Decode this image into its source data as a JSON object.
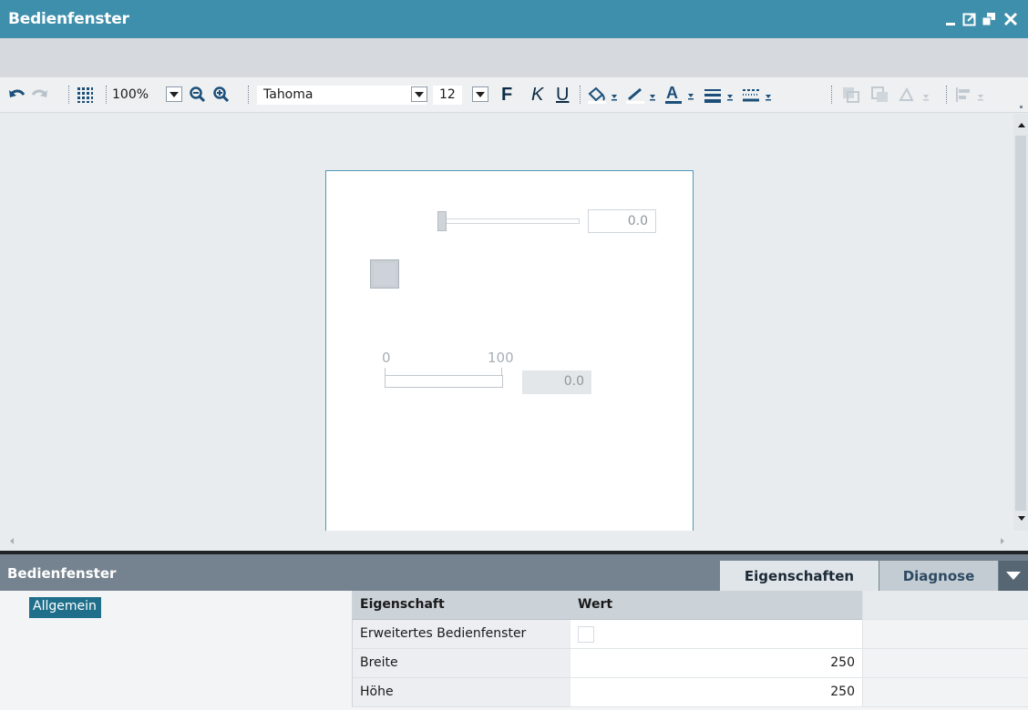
{
  "window": {
    "title": "Bedienfenster"
  },
  "toolbar": {
    "zoom": "100%",
    "font_family": "Tahoma",
    "font_size": "12",
    "bold_label": "F",
    "italic_label": "K",
    "underline_label": "U",
    "icons": [
      "undo-icon",
      "redo-icon",
      "grid-icon",
      "zoom-out-icon",
      "zoom-in-icon",
      "fill-color-icon",
      "line-color-icon",
      "font-color-icon",
      "line-width-icon",
      "line-style-icon",
      "bring-front-icon",
      "send-back-icon",
      "rotate-icon",
      "align-icon"
    ]
  },
  "panel": {
    "slider_value": "0.0",
    "bar_min": "0",
    "bar_max": "100",
    "bar_value": "0.0"
  },
  "inspector": {
    "title": "Bedienfenster",
    "tabs": [
      {
        "label": "Eigenschaften",
        "active": true
      },
      {
        "label": "Diagnose",
        "active": false
      }
    ],
    "nav": [
      {
        "label": "Allgemein",
        "selected": true
      }
    ],
    "table": {
      "headers": [
        "Eigenschaft",
        "Wert"
      ],
      "rows": [
        {
          "name": "Erweitertes Bedienfenster",
          "value": ""
        },
        {
          "name": "Breite",
          "value": "250"
        },
        {
          "name": "Höhe",
          "value": "250"
        }
      ]
    }
  },
  "colors": {
    "titlebar": "#3e8fab",
    "inspector_header": "#74838f",
    "selection": "#1f6f8b",
    "panel_border": "#4f97b5"
  }
}
